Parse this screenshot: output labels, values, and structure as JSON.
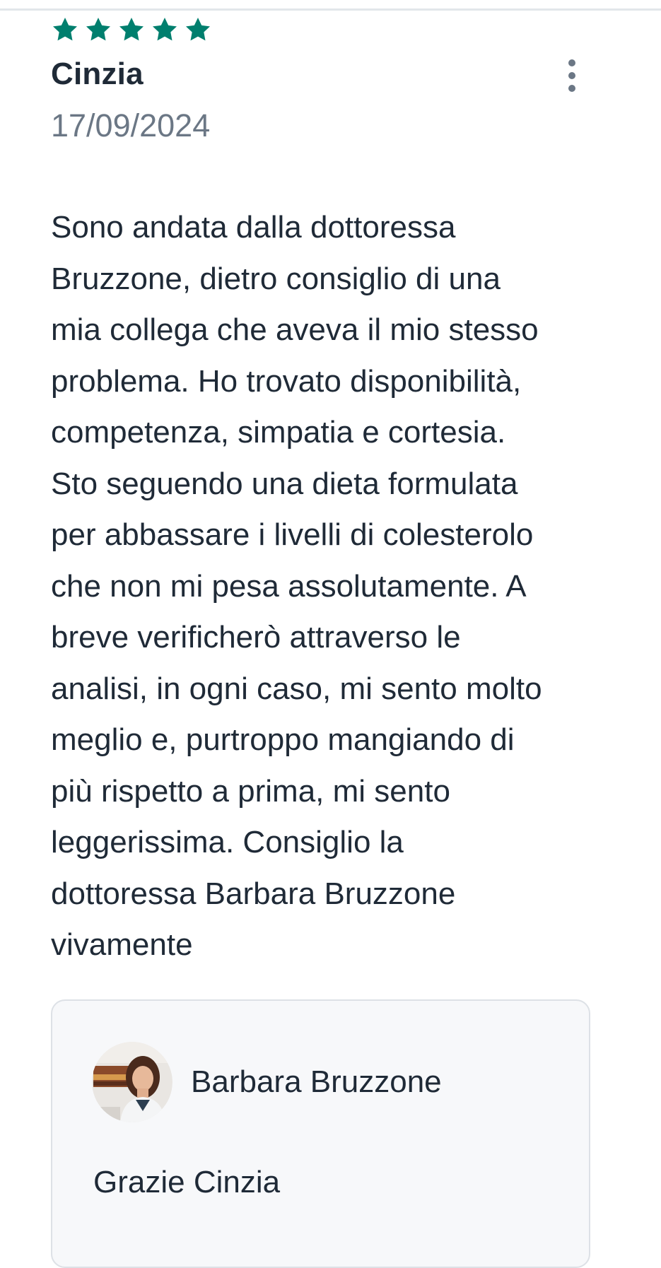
{
  "review": {
    "rating": 5,
    "rating_max": 5,
    "star_color": "#007f6e",
    "reviewer_name": "Cinzia",
    "date": "17/09/2024",
    "menu_icon": "more-vertical-icon",
    "text": "Sono andata dalla dottoressa\nBruzzone, dietro consiglio di una\nmia collega che aveva il mio stesso\nproblema. Ho trovato disponibilità,\ncompetenza, simpatia e cortesia.\nSto seguendo una dieta formulata\nper abbassare i livelli di colesterolo\nche non mi pesa assolutamente. A\nbreve verificherò attraverso le\nanalisi, in ogni caso, mi sento molto\nmeglio e, purtroppo mangiando di\npiù rispetto a prima, mi sento\nleggerissima. Consiglio la\ndottoressa Barbara Bruzzone\nvivamente"
  },
  "reply": {
    "author_name": "Barbara Bruzzone",
    "avatar_icon": "doctor-avatar",
    "text": "Grazie Cinzia"
  }
}
